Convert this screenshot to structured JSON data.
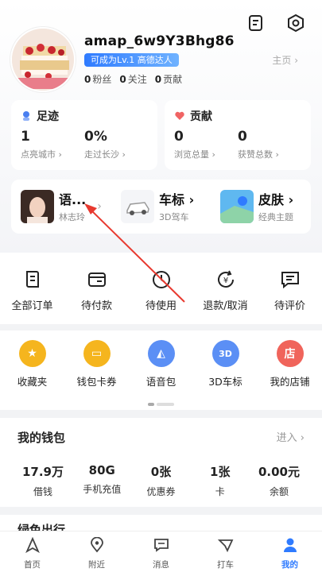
{
  "header": {
    "username": "amap_6w9Y3Bhg86",
    "level_badge": "可成为Lv.1 高德达人",
    "home_link": "主页 ›",
    "social": [
      {
        "value": "0",
        "label": "粉丝"
      },
      {
        "value": "0",
        "label": "关注"
      },
      {
        "value": "0",
        "label": "贡献"
      }
    ]
  },
  "footprint": {
    "title": "足迹",
    "stats": [
      {
        "value": "1",
        "label": "点亮城市 ›"
      },
      {
        "value": "0%",
        "label": "走过长沙 ›"
      }
    ]
  },
  "contribution": {
    "title": "贡献",
    "stats": [
      {
        "value": "0",
        "label": "浏览总量 ›"
      },
      {
        "value": "0",
        "label": "获赞总数 ›"
      }
    ]
  },
  "shortcuts": [
    {
      "title": "语...",
      "sub": "林志玲"
    },
    {
      "title": "车标 ›",
      "sub": "3D驾车"
    },
    {
      "title": "皮肤 ›",
      "sub": "经典主题"
    }
  ],
  "orders": [
    "全部订单",
    "待付款",
    "待使用",
    "退款/取消",
    "待评价"
  ],
  "services": [
    {
      "label": "收藏夹",
      "glyph": "★",
      "color": "#f5b51e"
    },
    {
      "label": "钱包卡券",
      "glyph": "▭",
      "color": "#f5b51e"
    },
    {
      "label": "语音包",
      "glyph": "◭",
      "color": "#5b8ff5"
    },
    {
      "label": "3D车标",
      "glyph": "3D",
      "color": "#5b8ff5"
    },
    {
      "label": "我的店铺",
      "glyph": "店",
      "color": "#f0645b"
    }
  ],
  "wallet": {
    "title": "我的钱包",
    "more": "进入 ›",
    "items": [
      {
        "value": "17.9万",
        "label": "借钱"
      },
      {
        "value": "80G",
        "label": "手机充值"
      },
      {
        "value": "0张",
        "label": "优惠券"
      },
      {
        "value": "1张",
        "label": "卡"
      },
      {
        "value": "0.00元",
        "label": "余额"
      }
    ]
  },
  "peek_title": "绿色出行",
  "tabs": [
    "首页",
    "附近",
    "消息",
    "打车",
    "我的"
  ],
  "colors": {
    "accent": "#2f7bff",
    "annotation_arrow": "#e8392f"
  }
}
